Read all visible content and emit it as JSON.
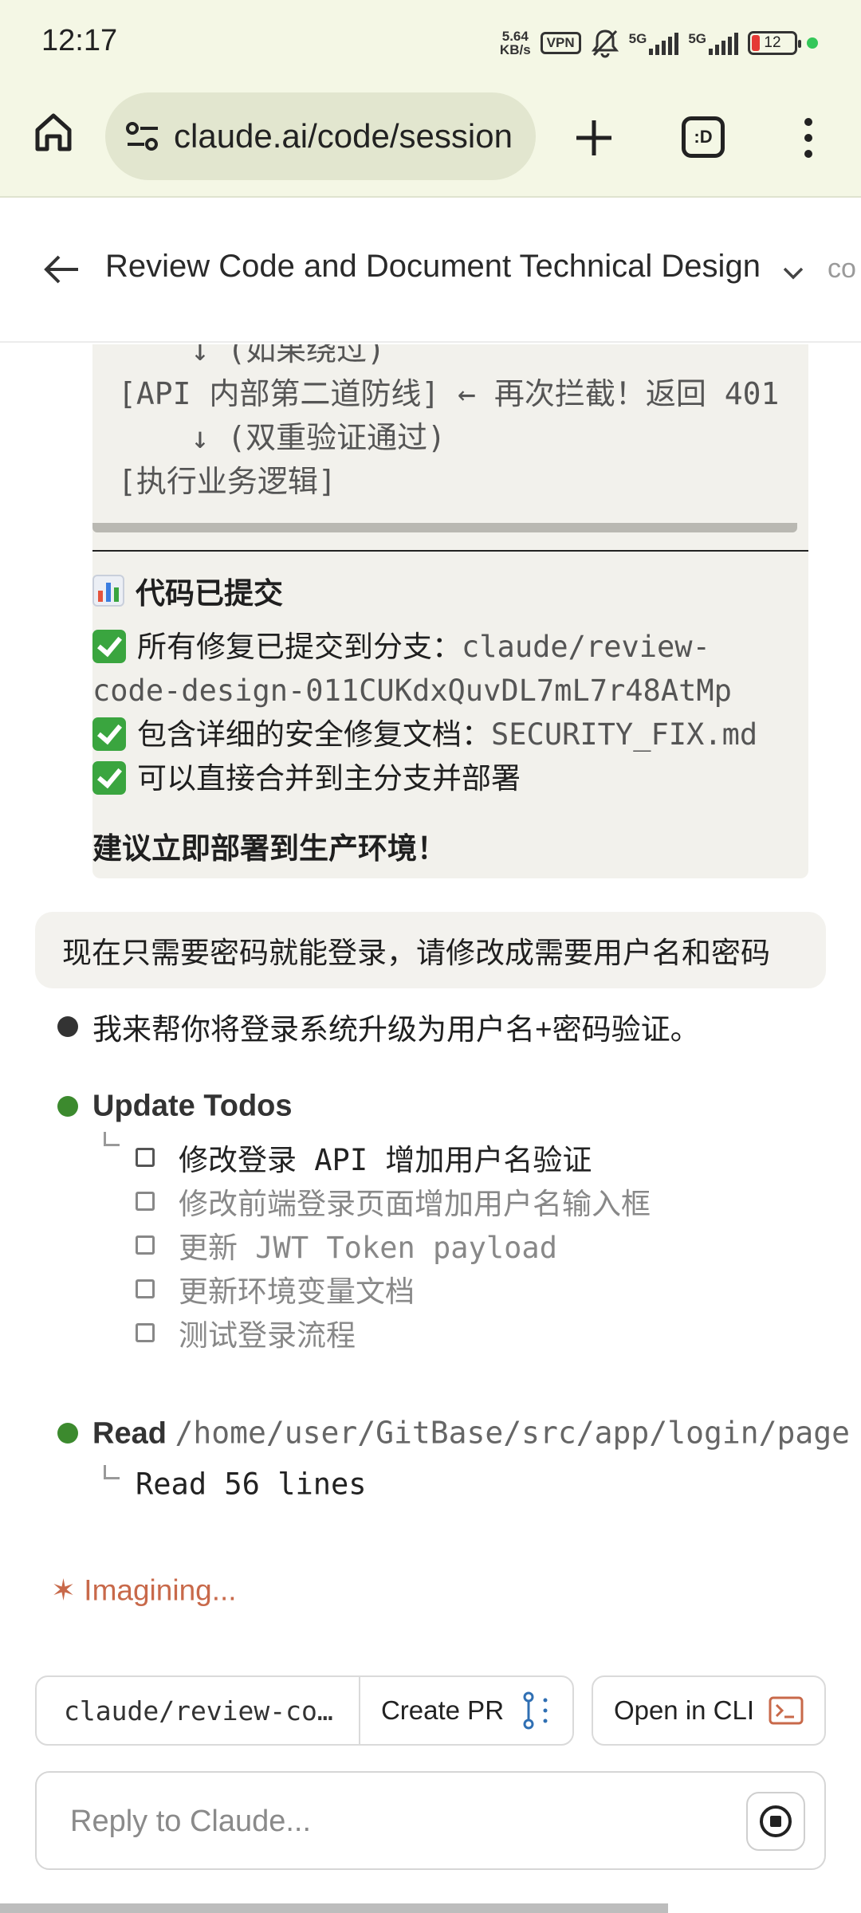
{
  "status_bar": {
    "time": "12:17",
    "net_speed_value": "5.64",
    "net_speed_unit": "KB/s",
    "vpn": "VPN",
    "sig1": "5G",
    "sig2": "5G",
    "battery": "12"
  },
  "browser": {
    "url": "claude.ai/code/session",
    "tab_glyph": ":D"
  },
  "header": {
    "title": "Review Code and Document Technical Design",
    "extra": "co"
  },
  "code_block": {
    "lines": [
      "    ↓ (如果绕过)",
      "[API 内部第二道防线] ← 再次拦截！返回 401",
      "    ↓ (双重验证通过)",
      "[执行业务逻辑]"
    ]
  },
  "summary": {
    "heading": "代码已提交",
    "item1_text": "所有修复已提交到分支：",
    "item1_code_a": "claude/review-",
    "item1_code_b": "code-design-011CUKdxQuvDL7mL7r48AtMp",
    "item2_text": "包含详细的安全修复文档：",
    "item2_code": "SECURITY_FIX.md",
    "item3_text": "可以直接合并到主分支并部署",
    "recommend": "建议立即部署到生产环境！"
  },
  "user_message": "现在只需要密码就能登录，请修改成需要用户名和密码",
  "assistant_reply": "我来帮你将登录系统升级为用户名+密码验证。",
  "todos": {
    "title": "Update Todos",
    "items": [
      "修改登录 API 增加用户名验证",
      "修改前端登录页面增加用户名输入框",
      "更新 JWT Token payload",
      "更新环境变量文档",
      "测试登录流程"
    ]
  },
  "read_tool": {
    "label": "Read",
    "path": "/home/user/GitBase/src/app/login/page",
    "result": "Read 56 lines"
  },
  "status_line": "Imagining...",
  "controls": {
    "branch": "claude/review-co…",
    "create_pr": "Create PR",
    "open_cli": "Open in CLI",
    "reply_placeholder": "Reply to Claude..."
  }
}
